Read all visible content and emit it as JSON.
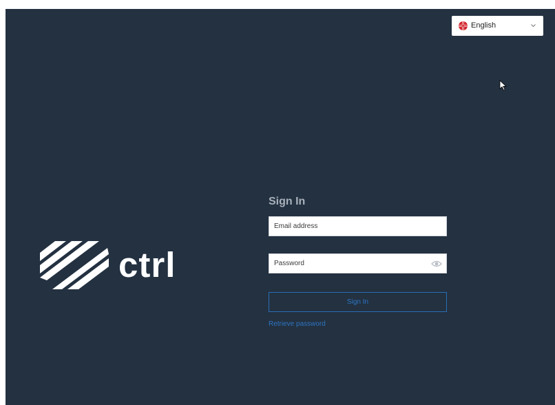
{
  "language": {
    "selected": "English",
    "flag_icon": "uk-flag-icon",
    "dropdown_icon": "chevron-down-icon"
  },
  "brand": {
    "wordmark": "ctrl",
    "logo_icon": "striped-chevrons-logo"
  },
  "signin": {
    "title": "Sign In",
    "email_placeholder": "Email address",
    "email_value": "",
    "password_placeholder": "Password",
    "password_value": "",
    "password_toggle_icon": "eye-icon",
    "submit_label": "Sign In",
    "retrieve_label": "Retrieve password"
  },
  "colors": {
    "background": "#233141",
    "accent": "#2e75c2",
    "title": "#a9b1bb"
  }
}
